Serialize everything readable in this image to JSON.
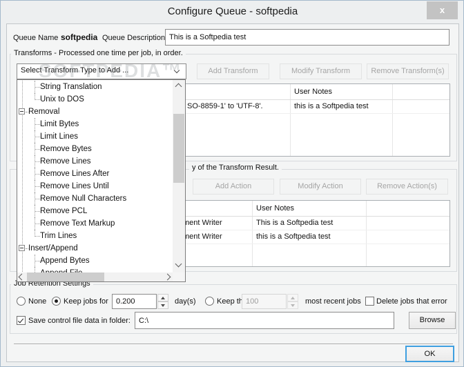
{
  "window": {
    "title": "Configure Queue - softpedia",
    "close_glyph": "x"
  },
  "watermark": "SOFTPEDIA™",
  "queue": {
    "name_label": "Queue Name",
    "name_value": "softpedia",
    "description_label": "Queue Description",
    "description_value": "This is a Softpedia test"
  },
  "transforms": {
    "group_label": "Transforms - Processed one time per job, in order.",
    "combo_value": "Select Transform Type to Add ...",
    "add_button": "Add Transform",
    "modify_button": "Modify Transform",
    "remove_button": "Remove Transform(s)",
    "table": {
      "user_notes_header": "User Notes",
      "rows": [
        {
          "description_fragment": "SO-8859-1' to 'UTF-8'.",
          "user_notes": "this is a Softpedia test"
        }
      ]
    }
  },
  "transform_dropdown": {
    "items": [
      {
        "label": "String Translation",
        "type": "leaf"
      },
      {
        "label": "Unix to DOS",
        "type": "leaf"
      },
      {
        "label": "Removal",
        "type": "group"
      },
      {
        "label": "Limit Bytes",
        "type": "leaf"
      },
      {
        "label": "Limit Lines",
        "type": "leaf"
      },
      {
        "label": "Remove Bytes",
        "type": "leaf"
      },
      {
        "label": "Remove Lines",
        "type": "leaf"
      },
      {
        "label": "Remove Lines After",
        "type": "leaf"
      },
      {
        "label": "Remove Lines Until",
        "type": "leaf"
      },
      {
        "label": "Remove Null Characters",
        "type": "leaf"
      },
      {
        "label": "Remove PCL",
        "type": "leaf"
      },
      {
        "label": "Remove Text Markup",
        "type": "leaf"
      },
      {
        "label": "Trim Lines",
        "type": "leaf"
      },
      {
        "label": "Insert/Append",
        "type": "group"
      },
      {
        "label": "Append Bytes",
        "type": "leaf"
      },
      {
        "label": "Append File",
        "type": "leaf"
      }
    ]
  },
  "actions": {
    "group_label_fragment": "y of the Transform Result.",
    "add_button": "Add Action",
    "modify_button": "Modify Action",
    "remove_button": "Remove Action(s)",
    "table": {
      "user_notes_header": "User Notes",
      "rows": [
        {
          "description_fragment": "ment Writer",
          "user_notes": "This is a Softpedia test"
        },
        {
          "description_fragment": "ment Writer",
          "user_notes": "this is a Softpedia test"
        }
      ]
    }
  },
  "retention": {
    "group_label": "Job Retention Settings",
    "none_label": "None",
    "keep_for_label": "Keep jobs for",
    "keep_for_value": "0.200",
    "days_label": "day(s)",
    "keep_the_label": "Keep the",
    "keep_the_value": "100",
    "recent_label": "most recent jobs",
    "delete_error_label": "Delete jobs that error",
    "save_control_label": "Save control file data in folder:",
    "folder_value": "C:\\",
    "browse_button": "Browse"
  },
  "footer": {
    "ok_button": "OK"
  }
}
